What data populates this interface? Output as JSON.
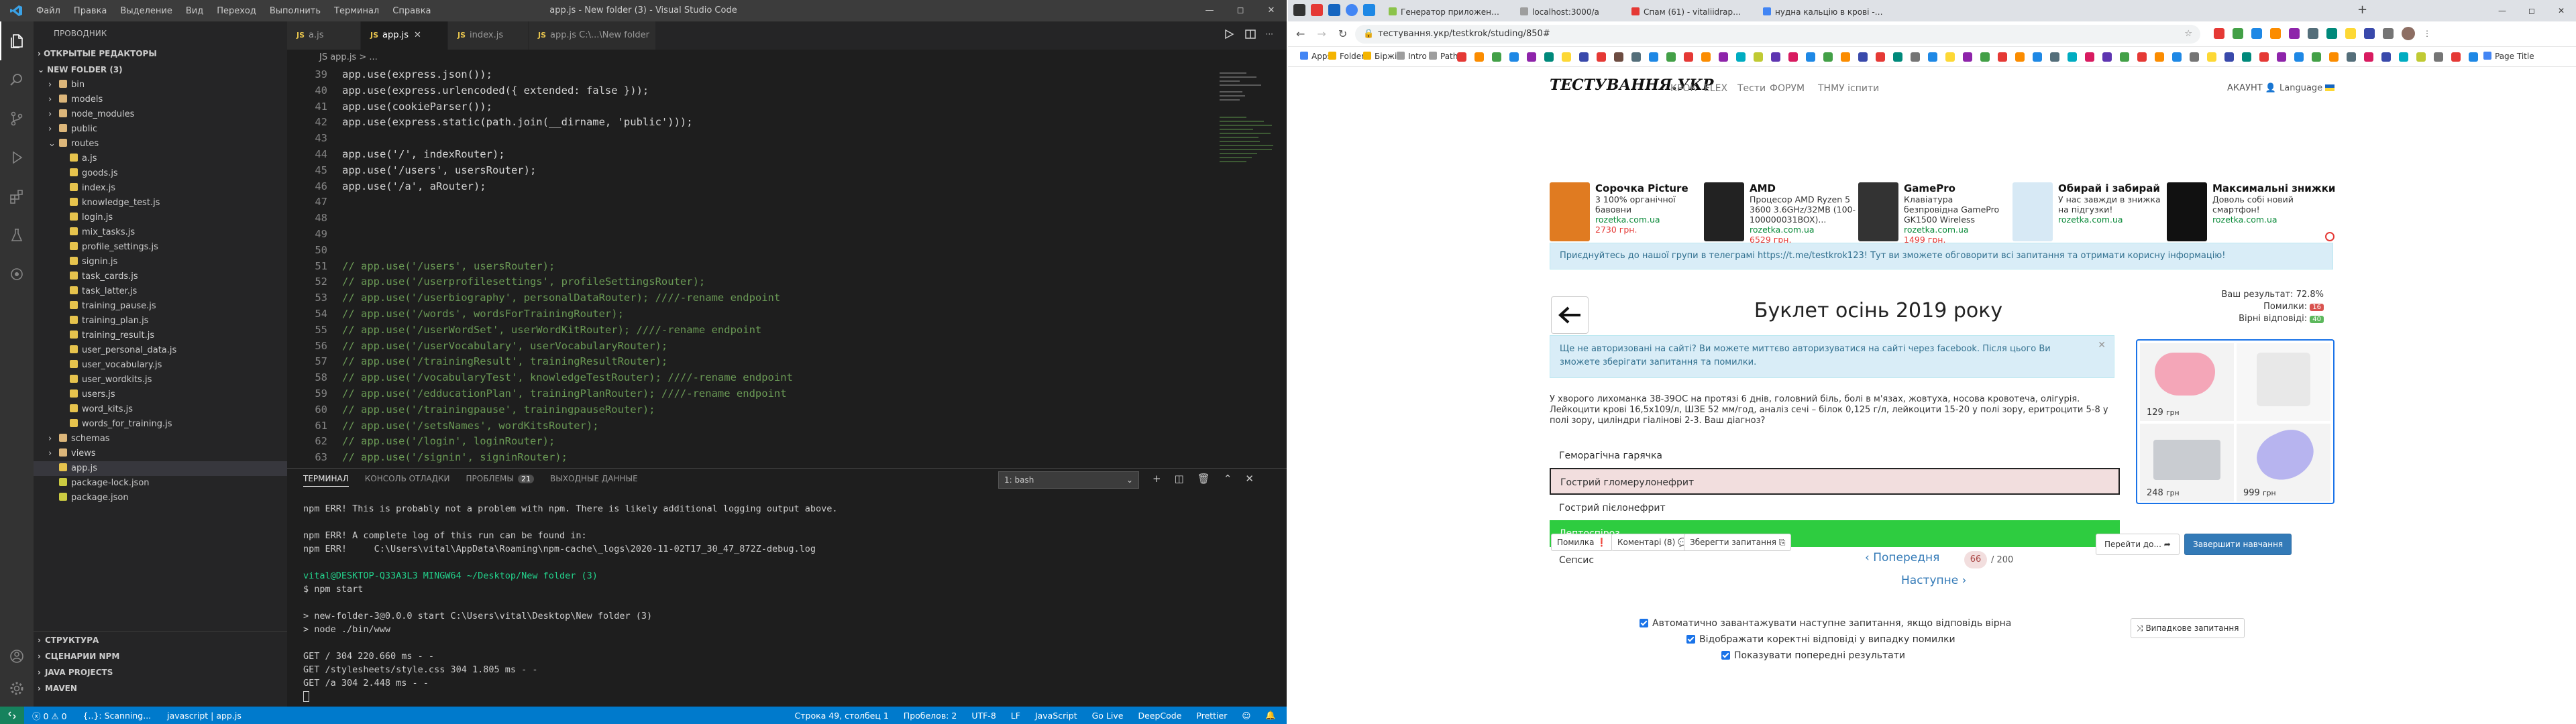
{
  "vscode": {
    "window_title": "app.js - New folder (3) - Visual Studio Code",
    "menu": [
      "Файл",
      "Правка",
      "Выделение",
      "Вид",
      "Переход",
      "Выполнить",
      "Терминал",
      "Справка"
    ],
    "explorer_title": "ПРОВОДНИК",
    "open_editors": "ОТКРЫТЫЕ РЕДАКТОРЫ",
    "folder": "NEW FOLDER (3)",
    "tree": [
      {
        "label": "bin",
        "type": "folder",
        "depth": 1,
        "open": false
      },
      {
        "label": "models",
        "type": "folder",
        "depth": 1,
        "open": false
      },
      {
        "label": "node_modules",
        "type": "folder",
        "depth": 1,
        "open": false
      },
      {
        "label": "public",
        "type": "folder",
        "depth": 1,
        "open": false
      },
      {
        "label": "routes",
        "type": "folder",
        "depth": 1,
        "open": true
      },
      {
        "label": "a.js",
        "type": "file",
        "depth": 2
      },
      {
        "label": "goods.js",
        "type": "file",
        "depth": 2
      },
      {
        "label": "index.js",
        "type": "file",
        "depth": 2
      },
      {
        "label": "knowledge_test.js",
        "type": "file",
        "depth": 2
      },
      {
        "label": "login.js",
        "type": "file",
        "depth": 2
      },
      {
        "label": "mix_tasks.js",
        "type": "file",
        "depth": 2
      },
      {
        "label": "profile_settings.js",
        "type": "file",
        "depth": 2
      },
      {
        "label": "signin.js",
        "type": "file",
        "depth": 2
      },
      {
        "label": "task_cards.js",
        "type": "file",
        "depth": 2
      },
      {
        "label": "task_latter.js",
        "type": "file",
        "depth": 2
      },
      {
        "label": "training_pause.js",
        "type": "file",
        "depth": 2
      },
      {
        "label": "training_plan.js",
        "type": "file",
        "depth": 2
      },
      {
        "label": "training_result.js",
        "type": "file",
        "depth": 2
      },
      {
        "label": "user_personal_data.js",
        "type": "file",
        "depth": 2
      },
      {
        "label": "user_vocabulary.js",
        "type": "file",
        "depth": 2
      },
      {
        "label": "user_wordkits.js",
        "type": "file",
        "depth": 2
      },
      {
        "label": "users.js",
        "type": "file",
        "depth": 2
      },
      {
        "label": "word_kits.js",
        "type": "file",
        "depth": 2
      },
      {
        "label": "words_for_training.js",
        "type": "file",
        "depth": 2
      },
      {
        "label": "schemas",
        "type": "folder",
        "depth": 1,
        "open": false
      },
      {
        "label": "views",
        "type": "folder",
        "depth": 1,
        "open": false
      },
      {
        "label": "app.js",
        "type": "file",
        "depth": 1,
        "selected": true
      },
      {
        "label": "package-lock.json",
        "type": "json",
        "depth": 1
      },
      {
        "label": "package.json",
        "type": "json",
        "depth": 1
      }
    ],
    "bottom_sections": [
      "СТРУКТУРА",
      "СЦЕНАРИИ NPM",
      "JAVA PROJECTS",
      "MAVEN"
    ],
    "tabs": [
      {
        "label": "a.js",
        "active": false
      },
      {
        "label": "app.js",
        "active": true
      },
      {
        "label": "index.js",
        "active": false
      },
      {
        "label": "app.js  C:\\...\\New folder",
        "active": false
      }
    ],
    "breadcrumb": "JS app.js > ...",
    "code_lines": [
      {
        "n": "39",
        "t": "app.use(express.json());"
      },
      {
        "n": "40",
        "t": "app.use(express.urlencoded({ extended: false }));"
      },
      {
        "n": "41",
        "t": "app.use(cookieParser());"
      },
      {
        "n": "42",
        "t": "app.use(express.static(path.join(__dirname, 'public')));"
      },
      {
        "n": "43",
        "t": ""
      },
      {
        "n": "44",
        "t": "app.use('/', indexRouter);"
      },
      {
        "n": "45",
        "t": "app.use('/users', usersRouter);"
      },
      {
        "n": "46",
        "t": "app.use('/a', aRouter);"
      },
      {
        "n": "47",
        "t": ""
      },
      {
        "n": "48",
        "t": ""
      },
      {
        "n": "49",
        "t": ""
      },
      {
        "n": "50",
        "t": ""
      },
      {
        "n": "51",
        "t": "// app.use('/users', usersRouter);"
      },
      {
        "n": "52",
        "t": "// app.use('/userprofilesettings', profileSettingsRouter);"
      },
      {
        "n": "53",
        "t": "// app.use('/userbiography', personalDataRouter); ////-rename endpoint"
      },
      {
        "n": "54",
        "t": "// app.use('/words', wordsForTrainingRouter);"
      },
      {
        "n": "55",
        "t": "// app.use('/userWordSet', userWordKitRouter); ////-rename endpoint"
      },
      {
        "n": "56",
        "t": "// app.use('/userVocabulary', userVocabularyRouter);"
      },
      {
        "n": "57",
        "t": "// app.use('/trainingResult', trainingResultRouter);"
      },
      {
        "n": "58",
        "t": "// app.use('/vocabularyTest', knowledgeTestRouter); ////-rename endpoint"
      },
      {
        "n": "59",
        "t": "// app.use('/edducationPlan', trainingPlanRouter); ////-rename endpoint"
      },
      {
        "n": "60",
        "t": "// app.use('/trainingpause', trainingpauseRouter);"
      },
      {
        "n": "61",
        "t": "// app.use('/setsNames', wordKitsRouter);"
      },
      {
        "n": "62",
        "t": "// app.use('/login', loginRouter);"
      },
      {
        "n": "63",
        "t": "// app.use('/signin', signinRouter);"
      }
    ],
    "panel_tabs": [
      "ТЕРМИНАЛ",
      "КОНСОЛЬ ОТЛАДКИ",
      "ПРОБЛЕМЫ",
      "ВЫХОДНЫЕ ДАННЫЕ"
    ],
    "problems_count": "21",
    "terminal_select": "1: bash",
    "terminal_lines": [
      "npm ERR! This is probably not a problem with npm. There is likely additional logging output above.",
      "",
      "npm ERR! A complete log of this run can be found in:",
      "npm ERR!     C:\\Users\\vital\\AppData\\Roaming\\npm-cache\\_logs\\2020-11-02T17_30_47_872Z-debug.log",
      "",
      "vital@DESKTOP-Q33A3L3 MINGW64 ~/Desktop/New folder (3)",
      "$ npm start",
      "",
      "> new-folder-3@0.0.0 start C:\\Users\\vital\\Desktop\\New folder (3)",
      "> node ./bin/www",
      "",
      "GET / 304 220.660 ms - -",
      "GET /stylesheets/style.css 304 1.805 ms - -",
      "GET /a 304 2.448 ms - -"
    ],
    "status_left": [
      "ⓧ 0 ⚠ 0",
      "{..}: Scanning...",
      "javascript | app.js"
    ],
    "status_right": [
      "Строка 49, столбец 1",
      "Пробелов: 2",
      "UTF-8",
      "LF",
      "JavaScript",
      "Go Live",
      "DeepCode",
      "Prettier"
    ]
  },
  "chrome": {
    "tabs": [
      {
        "label": "Генератор приложений Express",
        "active": false
      },
      {
        "label": "localhost:3000/a",
        "active": false
      },
      {
        "label": "Спам (61) - vitaliidrapaluk@gm...",
        "active": false
      },
      {
        "label": "нудна кальцію в крові - Пошук...",
        "active": false
      }
    ],
    "url": "тестування.укр/testkrok/studing/850#",
    "bookmarks": [
      "Apps",
      "Folders",
      "Біржі",
      "Intro",
      "Path",
      "Page Title"
    ],
    "site": {
      "logo": "ТЕСТУВАННЯ.УКР",
      "nav": [
        "КРОК",
        "ELEX",
        "Тести",
        "ФОРУМ",
        "ТНМУ іспити"
      ],
      "account": "АКАУНТ",
      "language": "Language",
      "ads": [
        {
          "title": "Сорочка Picture",
          "desc": [
            "3 100% органічної",
            "бавовни"
          ],
          "url": "rozetka.com.ua",
          "price": "2730 грн."
        },
        {
          "title": "AMD",
          "desc": [
            "Процесор AMD Ryzen 5",
            "3600 3.6GHz/32MB (100-",
            "100000031BOX)..."
          ],
          "url": "rozetka.com.ua",
          "price": "6529 грн."
        },
        {
          "title": "GamePro",
          "desc": [
            "Клавіатура",
            "безпровідна GamePro",
            "GK1500 Wireless"
          ],
          "url": "rozetka.com.ua",
          "price": "1499 грн."
        },
        {
          "title": "Обирай і забирай",
          "desc": [
            "У нас завжди в знижка",
            "на підгузки!"
          ],
          "url": "rozetka.com.ua",
          "price": ""
        },
        {
          "title": "Максимальні знижки",
          "desc": [
            "Доволь собі новий",
            "смартфон!"
          ],
          "url": "rozetka.com.ua",
          "price": ""
        }
      ],
      "telegram": "Приєднуйтесь до нашої групи в телеграмі https://t.me/testkrok123! Тут ви зможете обговорити всі запитання та отримати корисну інформацію!",
      "results": {
        "label": "Ваш результат: 72.8%",
        "errors_label": "Помилки:",
        "errors": "16",
        "correct_label": "Вірні відповіді:",
        "correct": "40"
      },
      "title": "Буклет осінь 2019 року",
      "auth_notice": "Ще не авторизовані на сайті? Ви можете миттєво авторизуватися на сайті через facebook. Після цього Ви зможете зберігати запитання та помилки.",
      "question": "У хворого лихоманка 38-39ОС на протязі 6 днів, головний біль, болі в м'язах, жовтуха, носова кровотеча, олігурія. Лейкоцити крові 16,5х109/л, ШЗЕ 52 мм/год, аналіз сечі – білок 0,125 г/л, лейкоцити 15-20 у полі зору, еритроцити 5-8 у полі зору, циліндри гіалінові 2-3. Ваш діагноз?",
      "answers": [
        {
          "text": "Геморагічна гарячка",
          "state": "none"
        },
        {
          "text": "Гострий гломерулонефрит",
          "state": "wrong"
        },
        {
          "text": "Гострий пієлонефрит",
          "state": "none"
        },
        {
          "text": "Лептоспіроз",
          "state": "correct"
        },
        {
          "text": "Сепсис",
          "state": "none"
        }
      ],
      "buttons": {
        "error": "Помилка",
        "comments": "Коментарі (8)",
        "save": "Зберегти запитання",
        "goto": "Перейти до...",
        "finish": "Завершити навчання",
        "random": "Випадкове запитання"
      },
      "pager": {
        "prev": "Попередня",
        "current": "66",
        "total": "/ 200",
        "next": "Наступне"
      },
      "checkboxes": [
        "Автоматично завантажувати наступне запитання, якщо відповідь вірна",
        "Відображати коректні відповіді у випадку помилки",
        "Показувати попередні результати"
      ],
      "products": [
        {
          "price": "129",
          "currency": "грн"
        },
        {
          "price": "",
          "currency": ""
        },
        {
          "price": "248",
          "currency": "грн"
        },
        {
          "price": "999",
          "currency": "грн"
        }
      ]
    }
  }
}
